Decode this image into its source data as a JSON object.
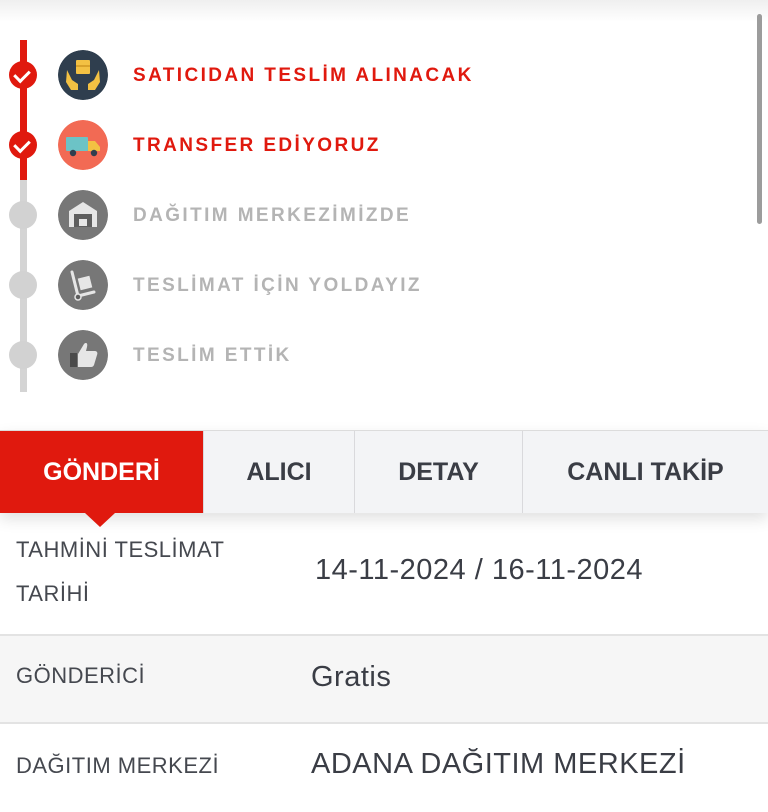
{
  "timeline": {
    "accent_color": "#e0190e",
    "inactive_color": "#b4b4b4",
    "steps": [
      {
        "label": "SATICIDAN TESLİM ALINACAK",
        "icon": "hands-package-icon",
        "status": "done"
      },
      {
        "label": "TRANSFER EDİYORUZ",
        "icon": "delivery-truck-icon",
        "status": "done"
      },
      {
        "label": "DAĞITIM MERKEZİMİZDE",
        "icon": "warehouse-icon",
        "status": "pending"
      },
      {
        "label": "TESLİMAT İÇİN YOLDAYIZ",
        "icon": "hand-truck-icon",
        "status": "pending"
      },
      {
        "label": "TESLİM ETTİK",
        "icon": "thumbs-up-icon",
        "status": "pending"
      }
    ]
  },
  "tabs": [
    {
      "label": "GÖNDERİ",
      "active": true
    },
    {
      "label": "ALICI",
      "active": false
    },
    {
      "label": "DETAY",
      "active": false
    },
    {
      "label": "CANLI TAKİP",
      "active": false
    }
  ],
  "details": {
    "estimated_delivery": {
      "label_line1": "TAHMİNİ TESLİMAT",
      "label_line2": "TARİHİ",
      "value": "14-11-2024 / 16-11-2024"
    },
    "sender": {
      "label": "GÖNDERİCİ",
      "value": "Gratis"
    },
    "distribution_center": {
      "label": "DAĞITIM MERKEZİ",
      "value": "ADANA DAĞITIM MERKEZİ"
    }
  }
}
